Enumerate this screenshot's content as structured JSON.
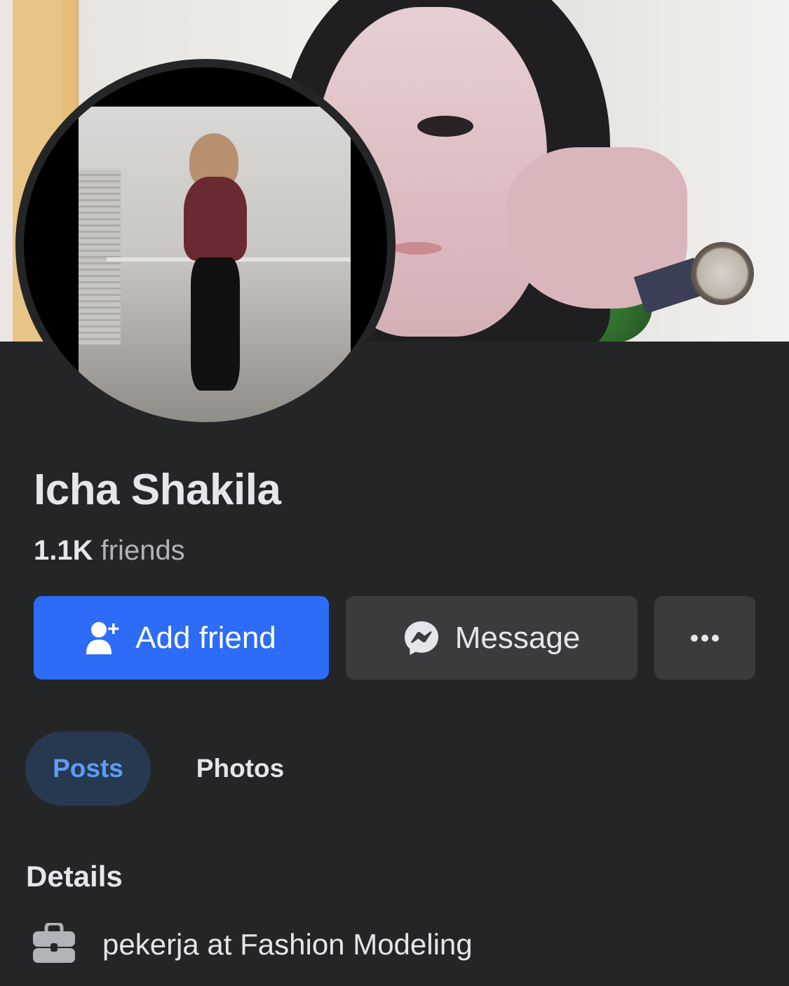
{
  "profile": {
    "name": "Icha Shakila",
    "friends_count": "1.1K",
    "friends_label": "friends"
  },
  "actions": {
    "add_friend_label": "Add friend",
    "message_label": "Message",
    "more_icon": "ellipsis-icon"
  },
  "tabs": [
    {
      "label": "Posts",
      "selected": true
    },
    {
      "label": "Photos",
      "selected": false
    }
  ],
  "details": {
    "title": "Details",
    "items": [
      {
        "icon": "briefcase-icon",
        "text": "pekerja at Fashion Modeling"
      }
    ]
  },
  "colors": {
    "background": "#242526",
    "primary_button": "#2d6cf6",
    "secondary_button": "#3a3b3c",
    "tab_selected_bg": "#263951",
    "tab_selected_text": "#5d9cf5"
  }
}
